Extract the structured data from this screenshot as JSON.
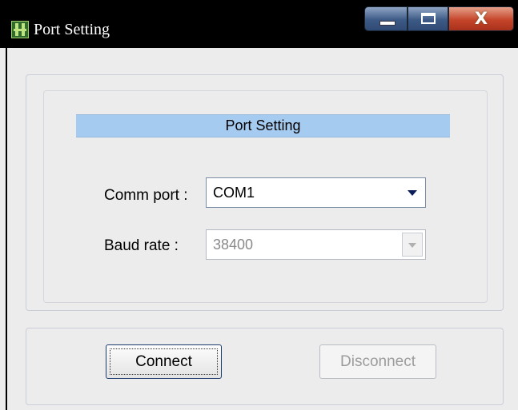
{
  "window": {
    "title": "Port Setting",
    "controls": {
      "close_glyph": "X"
    }
  },
  "section": {
    "header": "Port Setting"
  },
  "fields": {
    "comm_port": {
      "label": "Comm port :",
      "value": "COM1",
      "enabled": true
    },
    "baud_rate": {
      "label": "Baud rate :",
      "value": "38400",
      "enabled": false
    }
  },
  "buttons": {
    "connect": {
      "label": "Connect",
      "enabled": true
    },
    "disconnect": {
      "label": "Disconnect",
      "enabled": false
    }
  },
  "colors": {
    "header_band": "#a6cbf0",
    "title_bar": "#000000",
    "close_button": "#c5452a",
    "window_bg": "#ececec"
  },
  "icons": [
    "app-icon",
    "minimize-icon",
    "maximize-icon",
    "close-icon",
    "chevron-down-icon"
  ]
}
